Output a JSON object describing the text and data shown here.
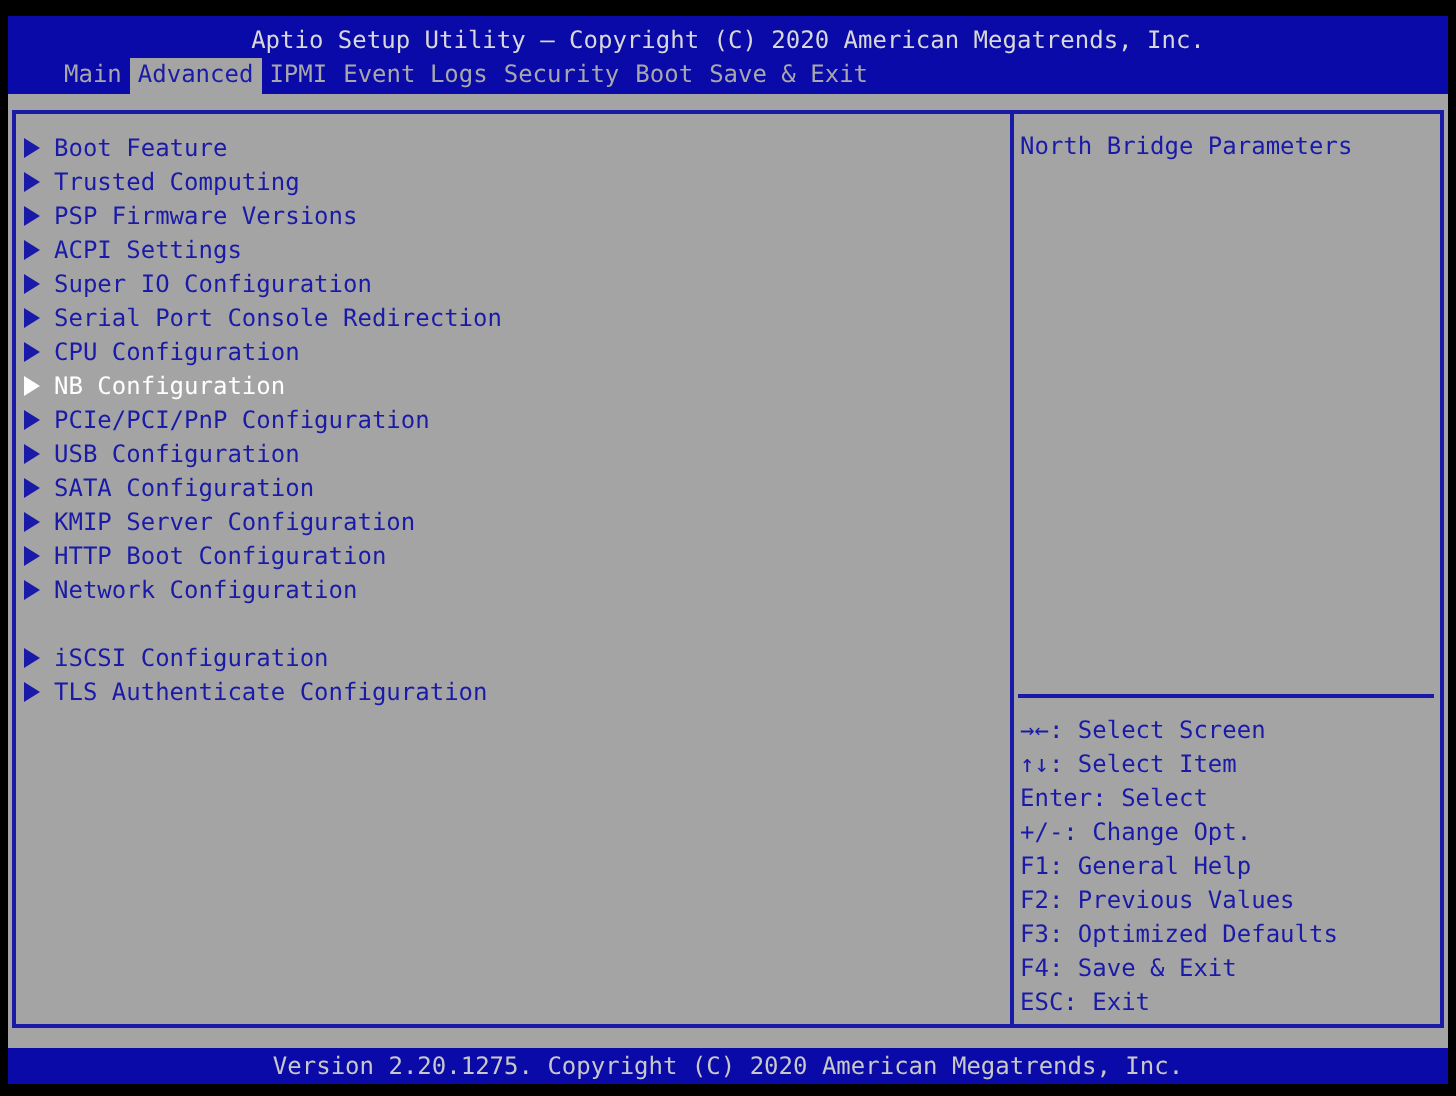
{
  "header": {
    "title": "Aptio Setup Utility – Copyright (C) 2020 American Megatrends, Inc."
  },
  "tabs": [
    {
      "label": "Main",
      "selected": false
    },
    {
      "label": "Advanced",
      "selected": true
    },
    {
      "label": "IPMI",
      "selected": false
    },
    {
      "label": "Event Logs",
      "selected": false
    },
    {
      "label": "Security",
      "selected": false
    },
    {
      "label": "Boot",
      "selected": false
    },
    {
      "label": "Save & Exit",
      "selected": false
    }
  ],
  "menu_groups": [
    {
      "items": [
        {
          "label": "Boot Feature",
          "selected": false
        },
        {
          "label": "Trusted Computing",
          "selected": false
        },
        {
          "label": "PSP Firmware Versions",
          "selected": false
        },
        {
          "label": "ACPI Settings",
          "selected": false
        },
        {
          "label": "Super IO Configuration",
          "selected": false
        },
        {
          "label": "Serial Port Console Redirection",
          "selected": false
        },
        {
          "label": "CPU Configuration",
          "selected": false
        },
        {
          "label": "NB Configuration",
          "selected": true
        },
        {
          "label": "PCIe/PCI/PnP Configuration",
          "selected": false
        },
        {
          "label": "USB Configuration",
          "selected": false
        },
        {
          "label": "SATA Configuration",
          "selected": false
        },
        {
          "label": "KMIP Server Configuration",
          "selected": false
        },
        {
          "label": "HTTP Boot Configuration",
          "selected": false
        },
        {
          "label": "Network Configuration",
          "selected": false
        }
      ]
    },
    {
      "items": [
        {
          "label": "iSCSI Configuration",
          "selected": false
        },
        {
          "label": "TLS Authenticate Configuration",
          "selected": false
        }
      ]
    }
  ],
  "help": {
    "description": "North Bridge Parameters",
    "keys": [
      "→←: Select Screen",
      "↑↓: Select Item",
      "Enter: Select",
      "+/-: Change Opt.",
      "F1: General Help",
      "F2: Previous Values",
      "F3: Optimized Defaults",
      "F4: Save & Exit",
      "ESC: Exit"
    ]
  },
  "footer": {
    "text": "Version 2.20.1275. Copyright (C) 2020 American Megatrends, Inc."
  }
}
